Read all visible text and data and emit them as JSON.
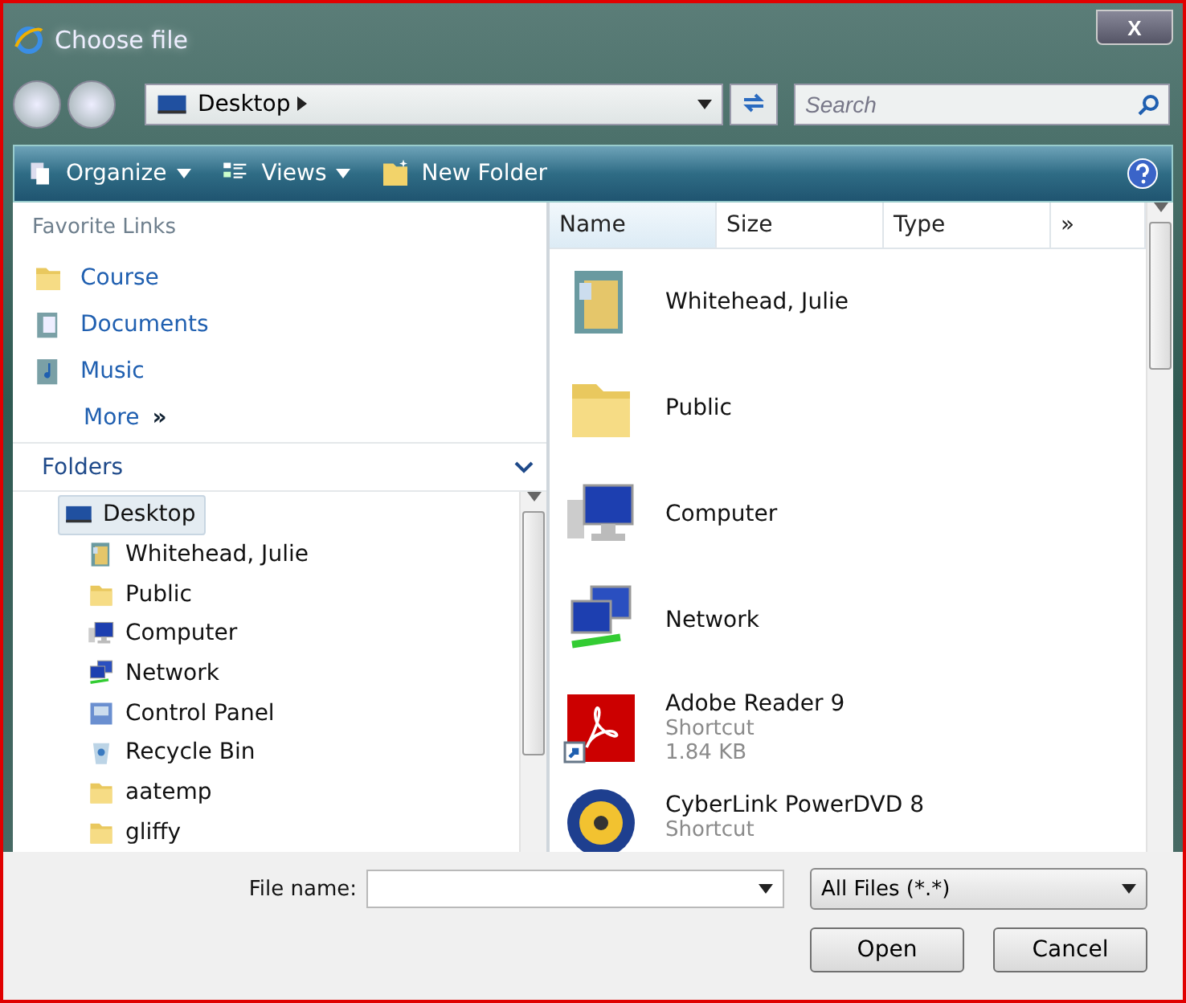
{
  "window": {
    "title": "Choose file",
    "close": "X"
  },
  "nav": {
    "address": "Desktop",
    "search_placeholder": "Search"
  },
  "toolbar": [
    {
      "label": "Organize",
      "kind": "organize",
      "menu": true
    },
    {
      "label": "Views",
      "kind": "views",
      "menu": true
    },
    {
      "label": "New Folder",
      "kind": "newfolder",
      "menu": false
    }
  ],
  "favorites": {
    "title": "Favorite Links",
    "items": [
      {
        "label": "Course",
        "kind": "folder"
      },
      {
        "label": "Documents",
        "kind": "documents"
      },
      {
        "label": "Music",
        "kind": "music"
      }
    ],
    "more": "More",
    "more_arrow": "»"
  },
  "folders": {
    "title": "Folders",
    "expanded": true,
    "tree": [
      {
        "label": "Desktop",
        "kind": "desktop",
        "selected": true,
        "children": [
          {
            "label": "Whitehead, Julie",
            "kind": "user",
            "selected": false
          },
          {
            "label": "Public",
            "kind": "folder",
            "selected": false
          },
          {
            "label": "Computer",
            "kind": "computer",
            "selected": false
          },
          {
            "label": "Network",
            "kind": "network",
            "selected": false
          },
          {
            "label": "Control Panel",
            "kind": "control",
            "selected": false
          },
          {
            "label": "Recycle Bin",
            "kind": "recycle",
            "selected": false
          },
          {
            "label": "aatemp",
            "kind": "folder",
            "selected": false
          },
          {
            "label": "gliffy",
            "kind": "folder",
            "selected": false
          }
        ]
      }
    ]
  },
  "columns": [
    "Name",
    "Size",
    "Type",
    "»"
  ],
  "files": [
    {
      "name": "Whitehead, Julie",
      "kind": "user"
    },
    {
      "name": "Public",
      "kind": "folder"
    },
    {
      "name": "Computer",
      "kind": "computer"
    },
    {
      "name": "Network",
      "kind": "network"
    },
    {
      "name": "Adobe Reader 9",
      "kind": "pdf",
      "details": [
        "Shortcut",
        "1.84 KB"
      ]
    },
    {
      "name": "CyberLink PowerDVD 8",
      "kind": "dvd",
      "details": [
        "Shortcut"
      ]
    }
  ],
  "footer": {
    "file_name_label": "File name:",
    "filter": "All Files (*.*)",
    "buttons": [
      "Open",
      "Cancel"
    ]
  }
}
